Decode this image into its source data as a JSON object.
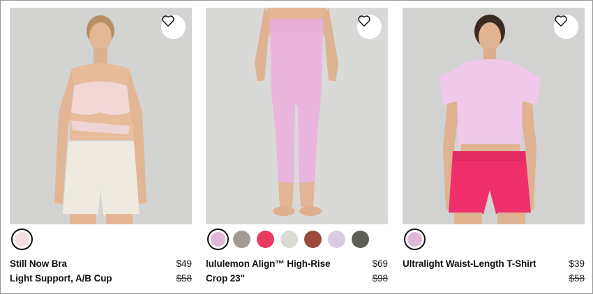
{
  "products": [
    {
      "name": "Still Now Bra",
      "subtitle": "Light Support, A/B Cup",
      "price": "$49",
      "original_price": "$58",
      "photo_bg": "#d3d3d2",
      "swatches": [
        "#f4dde0"
      ],
      "favorite_icon": "heart-outline-icon"
    },
    {
      "name": "lululemon Align™ High-Rise Crop 23\"",
      "price": "$69",
      "original_price": "$98",
      "photo_bg": "#d9d9d8",
      "swatches": [
        "#e2b6d6",
        "#a39b93",
        "#e8395f",
        "#d8dcd3",
        "#9b4a3c",
        "#d9cbe0",
        "#5d5f55"
      ],
      "favorite_icon": "heart-outline-icon"
    },
    {
      "name": "Ultralight Waist-Length T-Shirt",
      "price": "$39",
      "original_price": "$58",
      "photo_bg": "#d2d2d1",
      "swatches": [
        "#e2b7d7"
      ],
      "favorite_icon": "heart-outline-icon"
    }
  ]
}
